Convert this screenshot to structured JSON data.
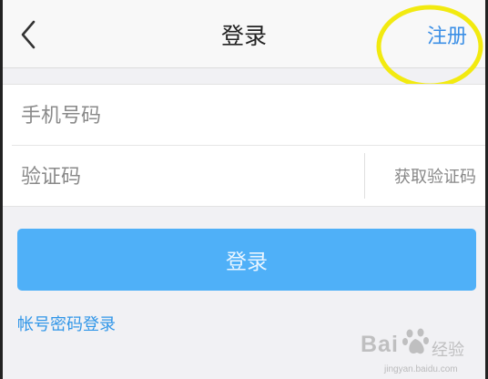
{
  "navbar": {
    "back_icon": "chevron-left-icon",
    "title": "登录",
    "register_label": "注册"
  },
  "form": {
    "phone_placeholder": "手机号码",
    "phone_value": "",
    "code_placeholder": "验证码",
    "code_value": "",
    "get_code_label": "获取验证码"
  },
  "login_button_label": "登录",
  "password_login_link": "帐号密码登录",
  "watermark": {
    "brand": "Bai",
    "brand_tail": "经验",
    "url": "jingyan.baidu.com"
  },
  "colors": {
    "accent_blue": "#3b8fe6",
    "login_button": "#4fb0f8",
    "highlight_annotation": "#f2ea10",
    "background": "#f1f1f4"
  }
}
